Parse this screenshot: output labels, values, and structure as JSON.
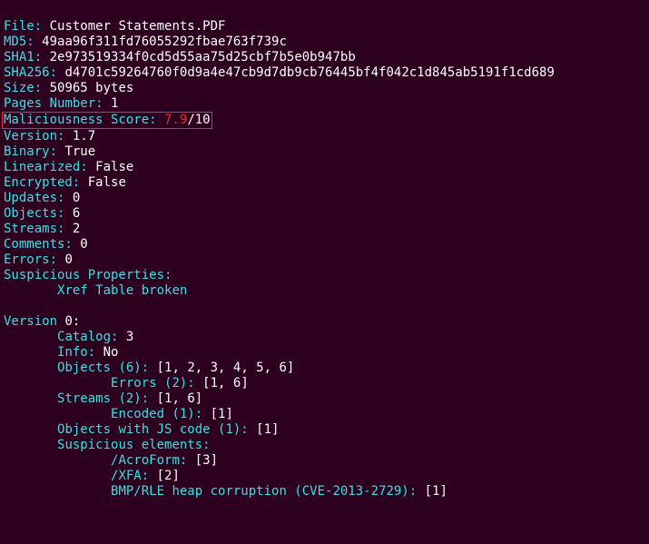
{
  "file": {
    "label": "File:",
    "value": "Customer Statements.PDF"
  },
  "md5": {
    "label": "MD5:",
    "value": "49aa96f311fd76055292fbae763f739c"
  },
  "sha1": {
    "label": "SHA1:",
    "value": "2e973519334f0cd5d55aa75d25cbf7b5e0b947bb"
  },
  "sha256": {
    "label": "SHA256:",
    "value": "d4701c59264760f0d9a4e47cb9d7db9cb76445bf4f042c1d845ab5191f1cd689"
  },
  "size": {
    "label": "Size:",
    "value": "50965 bytes"
  },
  "pages": {
    "label": "Pages Number:",
    "value": "1"
  },
  "malscore": {
    "label": "Maliciousness Score:",
    "value": "7.9",
    "total": "/10"
  },
  "pdfversion": {
    "label": "Version:",
    "value": "1.7"
  },
  "binary": {
    "label": "Binary:",
    "value": "True"
  },
  "linearized": {
    "label": "Linearized:",
    "value": "False"
  },
  "encrypted": {
    "label": "Encrypted:",
    "value": "False"
  },
  "updates": {
    "label": "Updates:",
    "value": "0"
  },
  "objects": {
    "label": "Objects:",
    "value": "6"
  },
  "streams": {
    "label": "Streams:",
    "value": "2"
  },
  "comments": {
    "label": "Comments:",
    "value": "0"
  },
  "errors": {
    "label": "Errors:",
    "value": "0"
  },
  "susp_props": {
    "label": "Suspicious Properties:",
    "items": [
      "Xref Table broken"
    ]
  },
  "v0": {
    "label": "Version",
    "value": "0:",
    "catalog": {
      "label": "Catalog:",
      "value": "3"
    },
    "info": {
      "label": "Info:",
      "value": "No"
    },
    "objects": {
      "label": "Objects (6):",
      "value": "[1, 2, 3, 4, 5, 6]",
      "errors": {
        "label": "Errors (2):",
        "value": "[1, 6]"
      }
    },
    "streams": {
      "label": "Streams (2):",
      "value": "[1, 6]",
      "encoded": {
        "label": "Encoded (1):",
        "value": "[1]"
      }
    },
    "js": {
      "label": "Objects with JS code (1):",
      "value": "[1]"
    },
    "susp": {
      "label": "Suspicious elements:",
      "acroform": {
        "label": "/AcroForm:",
        "value": "[3]"
      },
      "xfa": {
        "label": "/XFA:",
        "value": "[2]"
      },
      "cve": {
        "label": "BMP/RLE heap corruption (CVE-2013-2729):",
        "value": "[1]"
      }
    }
  }
}
